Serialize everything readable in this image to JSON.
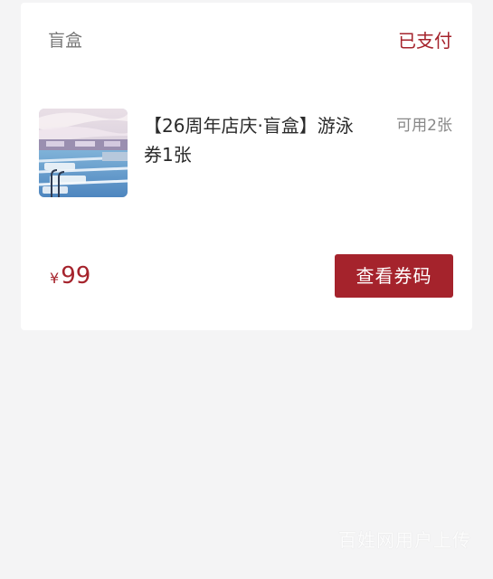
{
  "order_card": {
    "category": "盲盒",
    "status": "已支付",
    "product": {
      "title": "【26周年店庆·盲盒】游泳券1张",
      "available": "可用2张",
      "image": "swimming-pool-photo"
    },
    "price": {
      "currency": "¥",
      "amount": "99"
    },
    "view_code_label": "查看券码"
  },
  "watermark": "百姓网用户上传",
  "colors": {
    "accent": "#a5232c",
    "background": "#f4f4f5",
    "card": "#ffffff"
  }
}
